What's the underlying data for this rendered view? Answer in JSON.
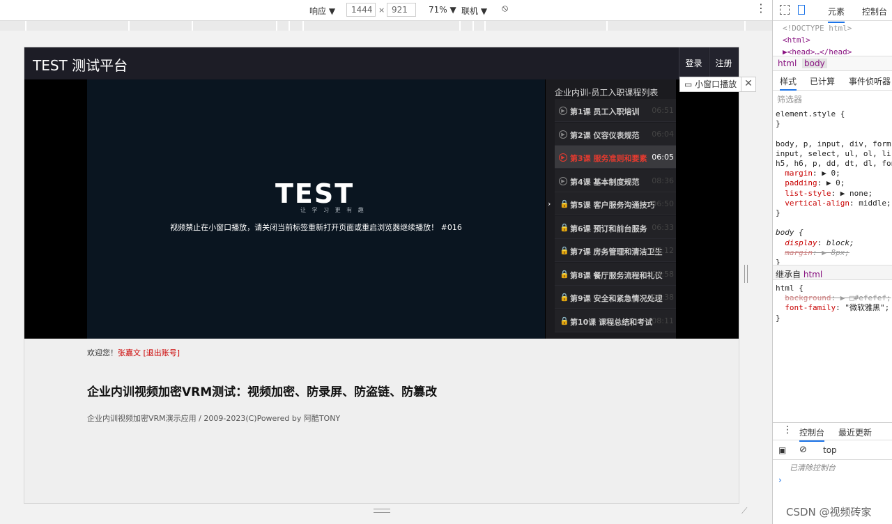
{
  "devtoolbar": {
    "mode": "响应 ▼",
    "width": "1444",
    "times": "×",
    "height": "921",
    "zoom": "71% ▼",
    "network": "联机 ▼"
  },
  "site": {
    "brand": "TEST 测试平台",
    "login": "登录",
    "register": "注册",
    "logo": "TEST",
    "logo_tagline": "让 学 习 更 有 趣",
    "notice": "视频禁止在小窗口播放，请关闭当前标签重新打开页面或重启浏览器继续播放！ #016",
    "mini_play": "小窗口播放",
    "close": "✕",
    "playlist_title": "企业内训-员工入职课程列表",
    "lessons": [
      {
        "name": "第1课 员工入职培训",
        "duration": "06:51",
        "status": "play"
      },
      {
        "name": "第2课 仪容仪表规范",
        "duration": "06:04",
        "status": "play"
      },
      {
        "name": "第3课 服务准则和要素",
        "duration": "06:05",
        "status": "active"
      },
      {
        "name": "第4课 基本制度规范",
        "duration": "08:36",
        "status": "play"
      },
      {
        "name": "第5课 客户服务沟通技巧",
        "duration": "06:50",
        "status": "locked"
      },
      {
        "name": "第6课 预订和前台服务",
        "duration": "06:33",
        "status": "locked"
      },
      {
        "name": "第7课 房务管理和清洁卫生",
        "duration": "07:12",
        "status": "locked"
      },
      {
        "name": "第8课 餐厅服务流程和礼仪",
        "duration": "06:58",
        "status": "locked"
      },
      {
        "name": "第9课 安全和紧急情况处理",
        "duration": "06:38",
        "status": "locked"
      },
      {
        "name": "第10课 课程总结和考试",
        "duration": "08:11",
        "status": "locked"
      }
    ],
    "welcome_prefix": "欢迎您！",
    "user": "张嘉文",
    "logout": "[退出账号]",
    "headline": "企业内训视频加密VRM测试：视频加密、防录屏、防盗链、防篡改",
    "footer": "企业内训视频加密VRM演示应用 / 2009-2023(C)Powered by 阿酷TONY"
  },
  "devtools": {
    "tab_elements": "元素",
    "tab_console": "控制台",
    "dom": [
      "<!DOCTYPE html>",
      "<html>",
      "▶<head>…</head>"
    ],
    "crumbs": [
      "html",
      "body"
    ],
    "style_tabs": [
      "样式",
      "已计算",
      "事件侦听器"
    ],
    "filter": "筛选器",
    "rule_element_selector": "element.style {",
    "rule_close": "}",
    "rule1_selector_l1": "body, p, input, div, form,",
    "rule1_selector_l2": "input, select, ul, ol, li,",
    "rule1_selector_l3": "h5, h6, p, dd, dt, dl, fon",
    "rule1_margin_prop": "margin",
    "rule1_margin_val": "0;",
    "rule1_padding_prop": "padding",
    "rule1_padding_val": "0;",
    "rule1_list_prop": "list-style",
    "rule1_list_val": "none;",
    "rule1_va_prop": "vertical-align",
    "rule1_va_val": "middle;",
    "rule2_selector": "body {",
    "rule2_display_prop": "display",
    "rule2_display_val": "block;",
    "rule2_margin_prop": "margin",
    "rule2_margin_val": "8px;",
    "inherit_label": "继承自",
    "inherit_tag": "html",
    "rule3_selector": "html {",
    "rule3_bg_prop": "background",
    "rule3_bg_val": "#efefef;",
    "rule3_ff_prop": "font-family",
    "rule3_ff_val": "\"微软雅黑\";",
    "console_tabs": [
      "控制台",
      "最近更新"
    ],
    "context": "top",
    "cleared": "已清除控制台",
    "prompt": "›"
  },
  "watermark": "CSDN @视频砖家"
}
